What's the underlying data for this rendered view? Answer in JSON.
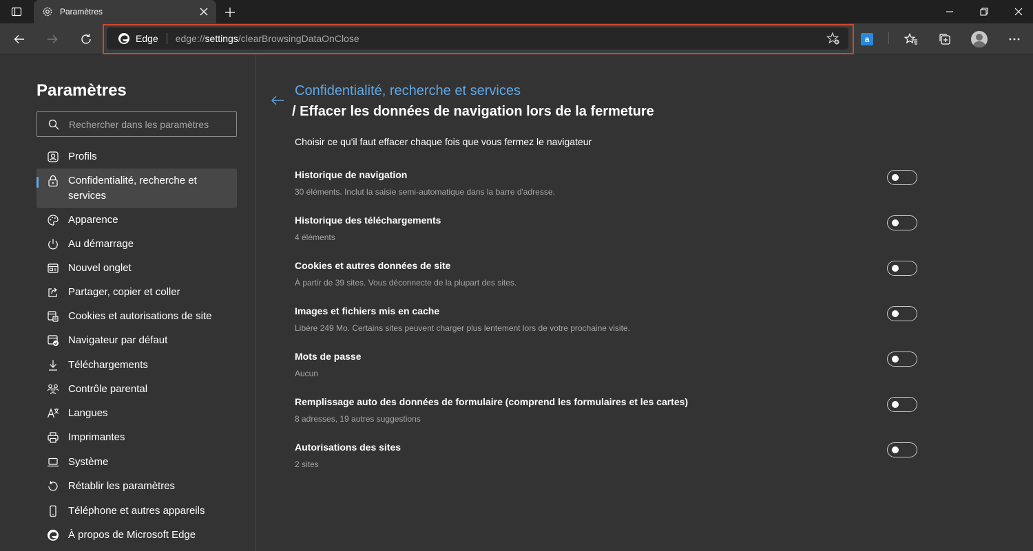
{
  "tab": {
    "title": "Paramètres"
  },
  "address": {
    "brand": "Edge",
    "url_prefix": "edge://",
    "url_bold": "settings",
    "url_suffix": "/clearBrowsingDataOnClose"
  },
  "extension": {
    "badge_letter": "a"
  },
  "sidebar": {
    "title": "Paramètres",
    "search_placeholder": "Rechercher dans les paramètres",
    "items": [
      {
        "label": "Profils",
        "icon": "profile-icon"
      },
      {
        "label": "Confidentialité, recherche et services",
        "icon": "lock-icon"
      },
      {
        "label": "Apparence",
        "icon": "palette-icon"
      },
      {
        "label": "Au démarrage",
        "icon": "power-icon"
      },
      {
        "label": "Nouvel onglet",
        "icon": "new-tab-icon"
      },
      {
        "label": "Partager, copier et coller",
        "icon": "share-icon"
      },
      {
        "label": "Cookies et autorisations de site",
        "icon": "cookie-icon"
      },
      {
        "label": "Navigateur par défaut",
        "icon": "browser-icon"
      },
      {
        "label": "Téléchargements",
        "icon": "download-icon"
      },
      {
        "label": "Contrôle parental",
        "icon": "family-icon"
      },
      {
        "label": "Langues",
        "icon": "language-icon"
      },
      {
        "label": "Imprimantes",
        "icon": "printer-icon"
      },
      {
        "label": "Système",
        "icon": "laptop-icon"
      },
      {
        "label": "Rétablir les paramètres",
        "icon": "reset-icon"
      },
      {
        "label": "Téléphone et autres appareils",
        "icon": "phone-icon"
      },
      {
        "label": "À propos de Microsoft Edge",
        "icon": "edge-icon"
      }
    ]
  },
  "main": {
    "breadcrumb_parent": "Confidentialité, recherche et services",
    "breadcrumb_current": "/ Effacer les données de navigation lors de la fermeture",
    "intro": "Choisir ce qu'il faut effacer chaque fois que vous fermez le navigateur",
    "options": [
      {
        "title": "Historique de navigation",
        "desc": "30 éléments. Inclut la saisie semi-automatique dans la barre d'adresse.",
        "enabled": false
      },
      {
        "title": "Historique des téléchargements",
        "desc": "4 éléments",
        "enabled": false
      },
      {
        "title": "Cookies et autres données de site",
        "desc": "À partir de 39 sites. Vous déconnecte de la plupart des sites.",
        "enabled": false
      },
      {
        "title": "Images et fichiers mis en cache",
        "desc": "Libère 249 Mo. Certains sites peuvent charger plus lentement lors de votre prochaine visite.",
        "enabled": false
      },
      {
        "title": "Mots de passe",
        "desc": "Aucun",
        "enabled": false
      },
      {
        "title": "Remplissage auto des données de formulaire (comprend les formulaires et les cartes)",
        "desc": "8 adresses, 19 autres suggestions",
        "enabled": false
      },
      {
        "title": "Autorisations des sites",
        "desc": "2 sites",
        "enabled": false
      }
    ]
  },
  "colors": {
    "accent": "#5fa8e8",
    "highlight_outline": "#d2452f",
    "background": "#333333"
  }
}
